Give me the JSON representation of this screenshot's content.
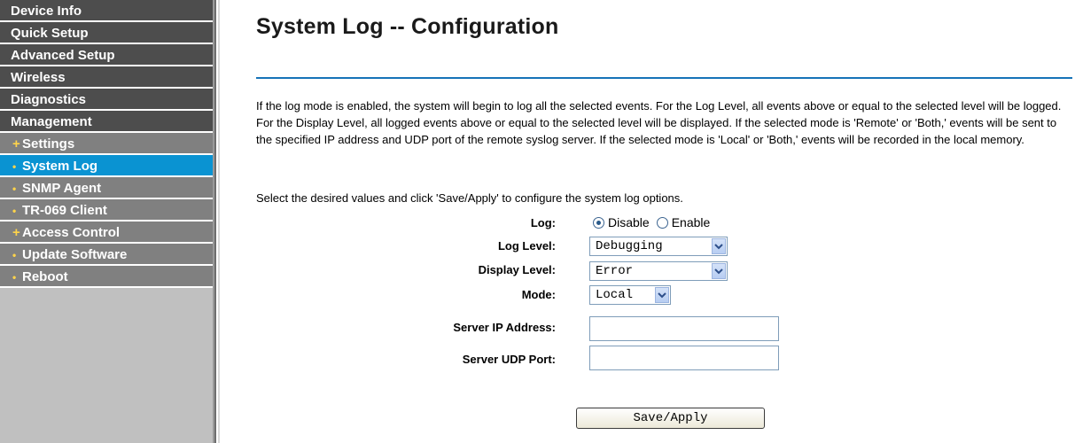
{
  "sidebar": {
    "items": [
      {
        "label": "Device Info",
        "level": "main",
        "bullet": ""
      },
      {
        "label": "Quick Setup",
        "level": "main",
        "bullet": ""
      },
      {
        "label": "Advanced Setup",
        "level": "main",
        "bullet": ""
      },
      {
        "label": "Wireless",
        "level": "main",
        "bullet": ""
      },
      {
        "label": "Diagnostics",
        "level": "main",
        "bullet": ""
      },
      {
        "label": "Management",
        "level": "main",
        "bullet": ""
      },
      {
        "label": "Settings",
        "level": "sub",
        "bullet": "+"
      },
      {
        "label": "System Log",
        "level": "sub",
        "bullet": "•",
        "active": true
      },
      {
        "label": "SNMP Agent",
        "level": "sub",
        "bullet": "•"
      },
      {
        "label": "TR-069 Client",
        "level": "sub",
        "bullet": "•"
      },
      {
        "label": "Access Control",
        "level": "sub",
        "bullet": "+"
      },
      {
        "label": "Update Software",
        "level": "sub",
        "bullet": "•"
      },
      {
        "label": "Reboot",
        "level": "sub",
        "bullet": "•"
      }
    ]
  },
  "main": {
    "title": "System Log -- Configuration",
    "description": "If the log mode is enabled, the system will begin to log all the selected events. For the Log Level, all events above or equal to the selected level will be logged. For the Display Level, all logged events above or equal to the selected level will be displayed. If the selected mode is 'Remote' or 'Both,' events will be sent to the specified IP address and UDP port of the remote syslog server. If the selected mode is 'Local' or 'Both,' events will be recorded in the local memory.",
    "instruction": "Select the desired values and click 'Save/Apply' to configure the system log options."
  },
  "form": {
    "log": {
      "label": "Log:",
      "options": [
        "Disable",
        "Enable"
      ],
      "selected": "Disable"
    },
    "log_level": {
      "label": "Log Level:",
      "value": "Debugging"
    },
    "display_level": {
      "label": "Display Level:",
      "value": "Error"
    },
    "mode": {
      "label": "Mode:",
      "value": "Local"
    },
    "server_ip": {
      "label": "Server IP Address:",
      "value": ""
    },
    "server_port": {
      "label": "Server UDP Port:",
      "value": ""
    },
    "save_label": "Save/Apply"
  },
  "colors": {
    "sidebar_main": "#4d4d4d",
    "sidebar_sub": "#808080",
    "sidebar_active": "#0a93d2",
    "divider": "#1673b8"
  }
}
